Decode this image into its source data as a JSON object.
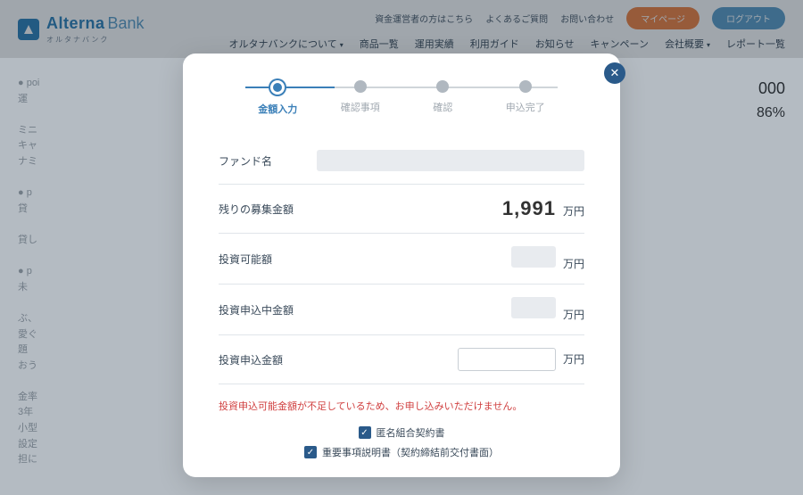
{
  "header": {
    "brand_main": "Alterna",
    "brand_sub": "Bank",
    "brand_kana": "オルタナバンク",
    "links": [
      "資金運営者の方はこちら",
      "よくあるご質問",
      "お問い合わせ"
    ],
    "btn_mypage": "マイページ",
    "btn_logout": "ログアウト",
    "nav": [
      "オルタナバンクについて",
      "商品一覧",
      "運用実績",
      "利用ガイド",
      "お知らせ",
      "キャンペーン",
      "会社概要",
      "レポート一覧"
    ]
  },
  "modal": {
    "steps": [
      "金額入力",
      "確認事項",
      "確認",
      "申込完了"
    ],
    "active_step": 0,
    "rows": {
      "fund_name": "ファンド名",
      "remaining": "残りの募集金額",
      "remaining_value": "1,991",
      "investable": "投資可能額",
      "pending": "投資申込中金額",
      "apply": "投資申込金額",
      "unit": "万円"
    },
    "error": "投資申込可能金額が不足しているため、お申し込みいただけません。",
    "checks": [
      "匿名組合契約書",
      "重要事項説明書（契約締結前交付書面）"
    ]
  },
  "bg_side": {
    "num1": "000",
    "num2": "86%"
  }
}
